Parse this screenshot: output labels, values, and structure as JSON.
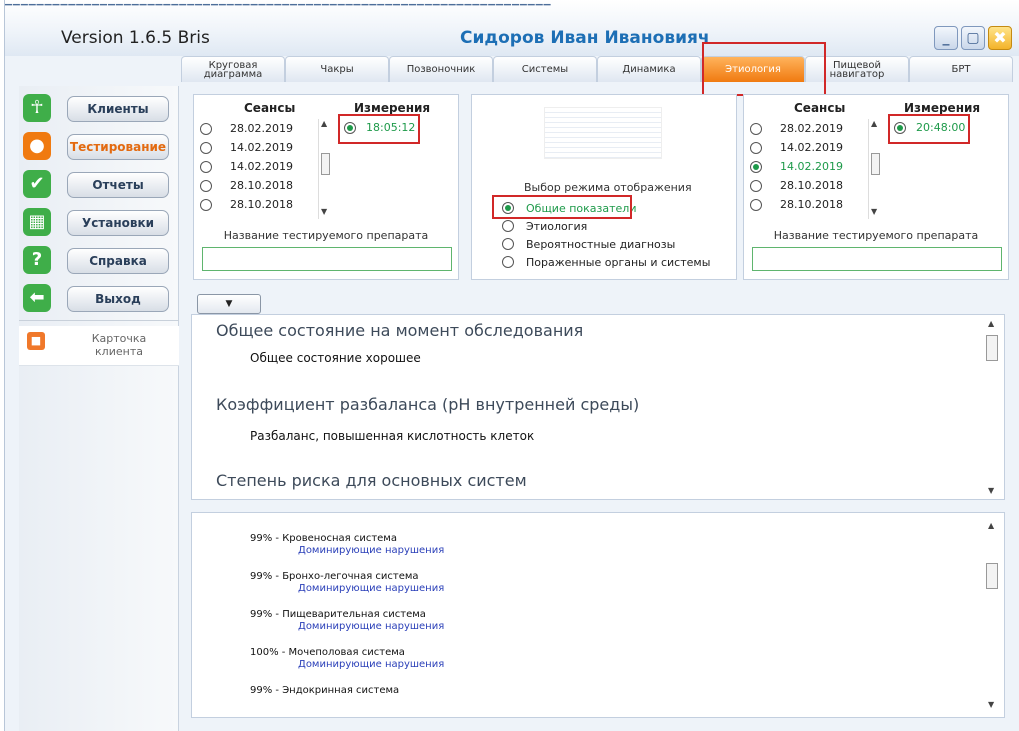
{
  "window": {
    "version": "Version 1.6.5 Bris",
    "user_name": "Сидоров Иван Ивановияч",
    "buttons": {
      "minimize": "_",
      "maximize": "▢",
      "close": "✖"
    }
  },
  "tabs": [
    {
      "label": "Круговая диаграмма"
    },
    {
      "label": "Чакры"
    },
    {
      "label": "Позвоночник"
    },
    {
      "label": "Системы"
    },
    {
      "label": "Динамика"
    },
    {
      "label": "Этиология",
      "active": true
    },
    {
      "label": "Пищевой навигатор"
    },
    {
      "label": "БРТ"
    }
  ],
  "sidebar": {
    "items": [
      {
        "label": "Клиенты",
        "icon": "person-icon",
        "color": "#3fae49"
      },
      {
        "label": "Тестирование",
        "icon": "person-icon",
        "color": "#f07a10",
        "active": true
      },
      {
        "label": "Отчеты",
        "icon": "check-icon",
        "color": "#3fae49"
      },
      {
        "label": "Установки",
        "icon": "grid-icon",
        "color": "#3fae49"
      },
      {
        "label": "Справка",
        "icon": "question-icon",
        "color": "#3fae49"
      },
      {
        "label": "Выход",
        "icon": "arrow-left-icon",
        "color": "#3fae49"
      }
    ],
    "card": {
      "label": "Карточка клиента",
      "icon": "card-icon"
    }
  },
  "left_panel": {
    "sessions_header": "Сеансы",
    "measurements_header": "Измерения",
    "sessions": [
      "28.02.2019",
      "14.02.2019",
      "14.02.2019",
      "28.10.2018",
      "28.10.2018"
    ],
    "selected_session": null,
    "measurement": "18:05:12",
    "drug_label": "Название тестируемого препарата",
    "drug_value": ""
  },
  "mode_panel": {
    "title": "Выбор режима отображения",
    "options": [
      {
        "label": "Общие показатели",
        "selected": true
      },
      {
        "label": "Этиология",
        "selected": false
      },
      {
        "label": "Вероятностные диагнозы",
        "selected": false
      },
      {
        "label": "Пораженные органы и системы",
        "selected": false
      }
    ]
  },
  "right_panel": {
    "sessions_header": "Сеансы",
    "measurements_header": "Измерения",
    "sessions": [
      "28.02.2019",
      "14.02.2019",
      "14.02.2019",
      "28.10.2018",
      "28.10.2018"
    ],
    "selected_session_index": 2,
    "measurement": "20:48:00",
    "drug_label": "Название тестируемого препарата",
    "drug_value": ""
  },
  "dropdown": {
    "value": ""
  },
  "content": {
    "sections": [
      {
        "heading": "Общее состояние на момент обследования",
        "text": "Общее состояние хорошее"
      },
      {
        "heading": "Коэффициент разбаланса (рН внутренней среды)",
        "text": "Разбаланс, повышенная кислотность клеток"
      },
      {
        "heading": "Степень риска для основных систем",
        "text": ""
      }
    ]
  },
  "systems": {
    "items": [
      {
        "label": "99% - Кровеносная система",
        "sub": "Доминирующие нарушения"
      },
      {
        "label": "99% - Бронхо-легочная система",
        "sub": "Доминирующие нарушения"
      },
      {
        "label": "99% - Пищеварительная система",
        "sub": "Доминирующие нарушения"
      },
      {
        "label": "100% - Мочеполовая система",
        "sub": "Доминирующие нарушения"
      },
      {
        "label": "99% - Эндокринная система",
        "sub": ""
      }
    ]
  }
}
